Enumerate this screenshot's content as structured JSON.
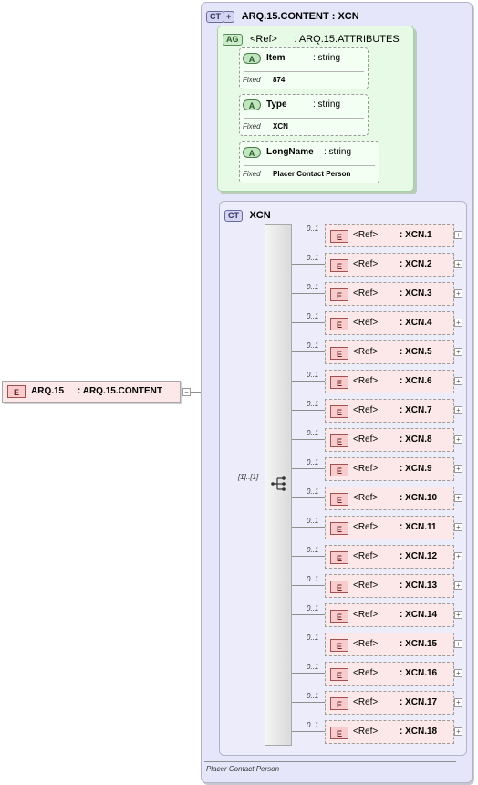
{
  "outer_type": {
    "badge": "CT",
    "title": "ARQ.15.CONTENT : XCN",
    "documentation": "Placer Contact Person"
  },
  "attribute_group": {
    "badge": "AG",
    "ref_label": "<Ref>",
    "type": ": ARQ.15.ATTRIBUTES"
  },
  "attributes": [
    {
      "badge": "A",
      "name": "Item",
      "type": ": string",
      "fixed_label": "Fixed",
      "fixed_value": "874"
    },
    {
      "badge": "A",
      "name": "Type",
      "type": ": string",
      "fixed_label": "Fixed",
      "fixed_value": "XCN"
    },
    {
      "badge": "A",
      "name": "LongName",
      "type": ": string",
      "fixed_label": "Fixed",
      "fixed_value": "Placer Contact Person"
    }
  ],
  "inner_type": {
    "badge": "CT",
    "title": "XCN"
  },
  "sequence": {
    "cardinality": "[1]..[1]"
  },
  "elements": [
    {
      "badge": "E",
      "ref": "<Ref>",
      "type": ": XCN.1",
      "cardinality": "0..1"
    },
    {
      "badge": "E",
      "ref": "<Ref>",
      "type": ": XCN.2",
      "cardinality": "0..1"
    },
    {
      "badge": "E",
      "ref": "<Ref>",
      "type": ": XCN.3",
      "cardinality": "0..1"
    },
    {
      "badge": "E",
      "ref": "<Ref>",
      "type": ": XCN.4",
      "cardinality": "0..1"
    },
    {
      "badge": "E",
      "ref": "<Ref>",
      "type": ": XCN.5",
      "cardinality": "0..1"
    },
    {
      "badge": "E",
      "ref": "<Ref>",
      "type": ": XCN.6",
      "cardinality": "0..1"
    },
    {
      "badge": "E",
      "ref": "<Ref>",
      "type": ": XCN.7",
      "cardinality": "0..1"
    },
    {
      "badge": "E",
      "ref": "<Ref>",
      "type": ": XCN.8",
      "cardinality": "0..1"
    },
    {
      "badge": "E",
      "ref": "<Ref>",
      "type": ": XCN.9",
      "cardinality": "0..1"
    },
    {
      "badge": "E",
      "ref": "<Ref>",
      "type": ": XCN.10",
      "cardinality": "0..1"
    },
    {
      "badge": "E",
      "ref": "<Ref>",
      "type": ": XCN.11",
      "cardinality": "0..1"
    },
    {
      "badge": "E",
      "ref": "<Ref>",
      "type": ": XCN.12",
      "cardinality": "0..1"
    },
    {
      "badge": "E",
      "ref": "<Ref>",
      "type": ": XCN.13",
      "cardinality": "0..1"
    },
    {
      "badge": "E",
      "ref": "<Ref>",
      "type": ": XCN.14",
      "cardinality": "0..1"
    },
    {
      "badge": "E",
      "ref": "<Ref>",
      "type": ": XCN.15",
      "cardinality": "0..1"
    },
    {
      "badge": "E",
      "ref": "<Ref>",
      "type": ": XCN.16",
      "cardinality": "0..1"
    },
    {
      "badge": "E",
      "ref": "<Ref>",
      "type": ": XCN.17",
      "cardinality": "0..1"
    },
    {
      "badge": "E",
      "ref": "<Ref>",
      "type": ": XCN.18",
      "cardinality": "0..1"
    }
  ],
  "root_element": {
    "badge": "E",
    "name": "ARQ.15",
    "type": ": ARQ.15.CONTENT"
  },
  "icons": {
    "expand": "plus-box-icon",
    "collapse": "minus-box-icon",
    "sequence": "sequence-compositor-icon"
  }
}
